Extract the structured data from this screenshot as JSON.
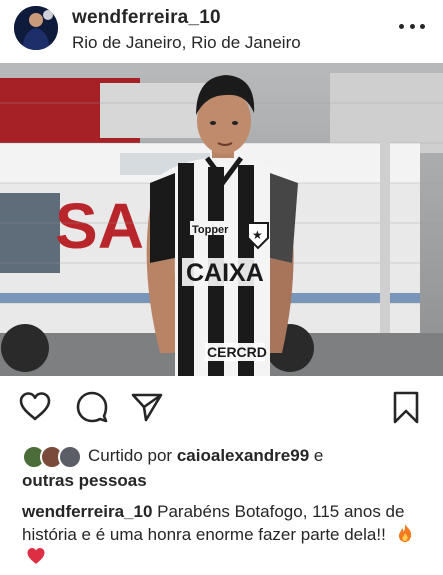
{
  "post": {
    "username": "wendferreira_10",
    "location": "Rio de Janeiro, Rio de Janeiro",
    "more_icon": "more-horizontal-icon"
  },
  "photo": {
    "jersey_sponsor": "CAIXA",
    "jersey_brand": "Topper",
    "jersey_bottom_text": "CERCRD",
    "background_vehicle_text": "SA   M"
  },
  "actions": {
    "like_icon": "heart-icon",
    "comment_icon": "comment-icon",
    "share_icon": "send-icon",
    "save_icon": "bookmark-icon"
  },
  "likes": {
    "prefix": "Curtido por",
    "user": "caioalexandre99",
    "connector": "e",
    "others": "outras pessoas"
  },
  "caption": {
    "username": "wendferreira_10",
    "text": "Parabéns Botafogo, 115 anos de história e é uma honra enorme fazer parte dela!!",
    "emojis": [
      "fire-emoji",
      "red-heart-emoji"
    ]
  }
}
